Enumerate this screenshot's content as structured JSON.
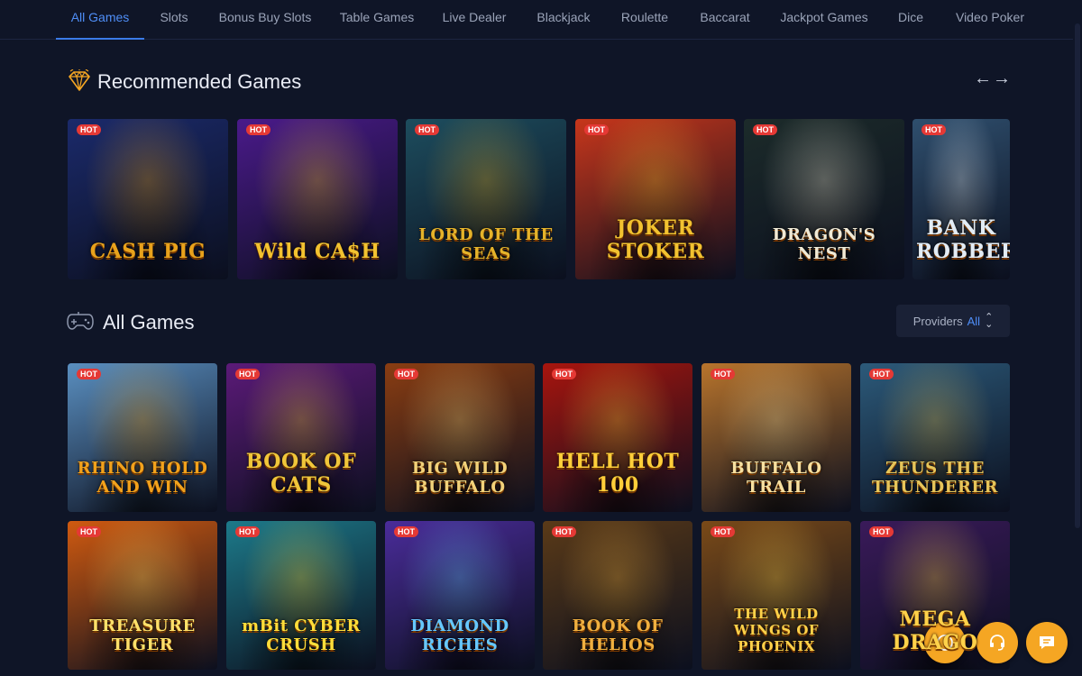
{
  "tabs": [
    {
      "label": "All Games",
      "active": true
    },
    {
      "label": "Slots"
    },
    {
      "label": "Bonus Buy Slots"
    },
    {
      "label": "Table Games"
    },
    {
      "label": "Live Dealer"
    },
    {
      "label": "Blackjack"
    },
    {
      "label": "Roulette"
    },
    {
      "label": "Baccarat"
    },
    {
      "label": "Jackpot Games"
    },
    {
      "label": "Dice"
    },
    {
      "label": "Video Poker"
    }
  ],
  "recommended": {
    "title": "Recommended Games",
    "icon": "diamond-icon",
    "prev_icon": "arrow-left-icon",
    "next_icon": "arrow-right-icon",
    "badge": "HOT",
    "games": [
      {
        "name": "CASH PIG",
        "bg": "#1b2a6b",
        "accent": "#e8a21c"
      },
      {
        "name": "Wild CA$H",
        "bg": "#4a1a8a",
        "accent": "#f2c230"
      },
      {
        "name": "LORD OF THE SEAS",
        "bg": "#1d4d5e",
        "accent": "#e5b32a"
      },
      {
        "name": "JOKER STOKER",
        "bg": "#c7361b",
        "accent": "#f2c230"
      },
      {
        "name": "DRAGON'S NEST",
        "bg": "#1c2b2a",
        "accent": "#f0ead6"
      },
      {
        "name": "BANK ROBBERS",
        "bg": "#2f4f6e",
        "accent": "#e2ecf5"
      }
    ]
  },
  "all_games": {
    "title": "All Games",
    "icon": "gamepad-icon",
    "providers_label": "Providers",
    "providers_value": "All",
    "badge": "HOT",
    "games": [
      {
        "name": "RHINO HOLD AND WIN",
        "bg": "#5a8fc0",
        "accent": "#f2a21c"
      },
      {
        "name": "BOOK OF CATS",
        "bg": "#5b1a78",
        "accent": "#f0c63a"
      },
      {
        "name": "BIG WILD BUFFALO",
        "bg": "#8a3d12",
        "accent": "#f2d27a"
      },
      {
        "name": "HELL HOT 100",
        "bg": "#a8150e",
        "accent": "#ffcf3a"
      },
      {
        "name": "BUFFALO TRAIL",
        "bg": "#b8742c",
        "accent": "#f7e0a0"
      },
      {
        "name": "ZEUS THE THUNDERER",
        "bg": "#2c5a7a",
        "accent": "#e6c55a"
      },
      {
        "name": "TREASURE TIGER",
        "bg": "#d05a10",
        "accent": "#ffe16a"
      },
      {
        "name": "mBit CYBER CRUSH",
        "bg": "#1d7a8a",
        "accent": "#ffde3a"
      },
      {
        "name": "DIAMOND RICHES",
        "bg": "#4a2c9a",
        "accent": "#66c8ff"
      },
      {
        "name": "BOOK OF HELIOS",
        "bg": "#5a3a18",
        "accent": "#f0b040"
      },
      {
        "name": "THE WILD WINGS OF PHOENIX",
        "bg": "#7a4a18",
        "accent": "#ffd24a"
      },
      {
        "name": "MEGA DRAGO",
        "bg": "#3a1a5a",
        "accent": "#ffd24a"
      }
    ]
  },
  "fabs": [
    {
      "icon": "clock-icon"
    },
    {
      "icon": "headset-icon"
    },
    {
      "icon": "chat-icon"
    }
  ]
}
